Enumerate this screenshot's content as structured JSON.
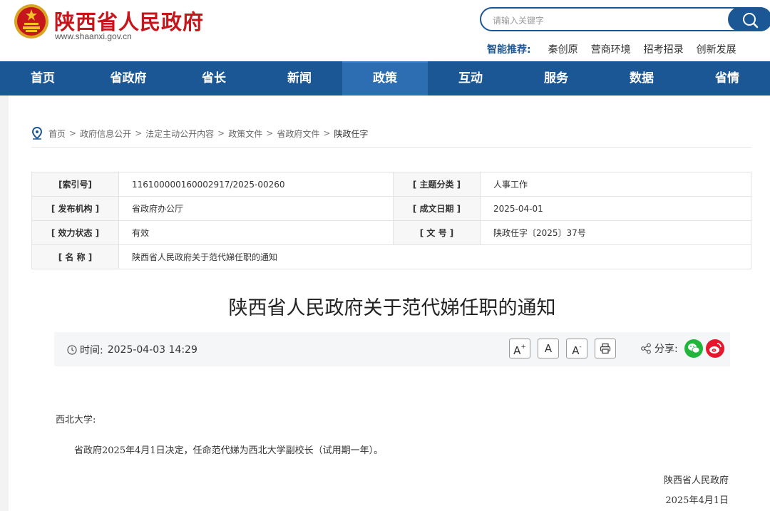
{
  "header": {
    "site_name": "陕西省人民政府",
    "site_url": "www.shaanxi.gov.cn",
    "search_placeholder": "请输入关键字",
    "recommend_label": "智能推荐:",
    "recommend_links": [
      "秦创原",
      "营商环境",
      "招考招录",
      "创新发展"
    ]
  },
  "nav": {
    "items": [
      "首页",
      "省政府",
      "省长",
      "新闻",
      "政策",
      "互动",
      "服务",
      "数据",
      "省情"
    ],
    "active_index": 4
  },
  "breadcrumb": {
    "items": [
      "首页",
      "政府信息公开",
      "法定主动公开内容",
      "政策文件",
      "省政府文件",
      "陕政任字"
    ],
    "separator": ">"
  },
  "meta": {
    "index_label": "[索引号]",
    "index_value": "116100000160002917/2025-00260",
    "topic_label": "[ 主题分类 ]",
    "topic_value": "人事工作",
    "publisher_label": "[ 发布机构 ]",
    "publisher_value": "省政府办公厅",
    "date_label": "[ 成文日期 ]",
    "date_value": "2025-04-01",
    "status_label": "[ 效力状态 ]",
    "status_value": "有效",
    "docno_label": "[ 文 号 ]",
    "docno_value": "陕政任字〔2025〕37号",
    "name_label": "[ 名 称 ]",
    "name_value": "陕西省人民政府关于范代娣任职的通知"
  },
  "article": {
    "title": "陕西省人民政府关于范代娣任职的通知",
    "time_label": "时间:",
    "time_value": "2025-04-03 14:29",
    "font_large": "A",
    "font_normal": "A",
    "font_small": "A",
    "share_label": "分享:",
    "salutation": "西北大学:",
    "paragraph": "省政府2025年4月1日决定，任命范代娣为西北大学副校长（试用期一年）。",
    "signature": "陕西省人民政府",
    "sign_date": "2025年4月1日"
  },
  "colors": {
    "brand_red": "#c6161c",
    "nav_blue": "#1b5795",
    "nav_active": "#2d6db1",
    "wechat_green": "#20b63b",
    "weibo_red": "#e6162d"
  }
}
